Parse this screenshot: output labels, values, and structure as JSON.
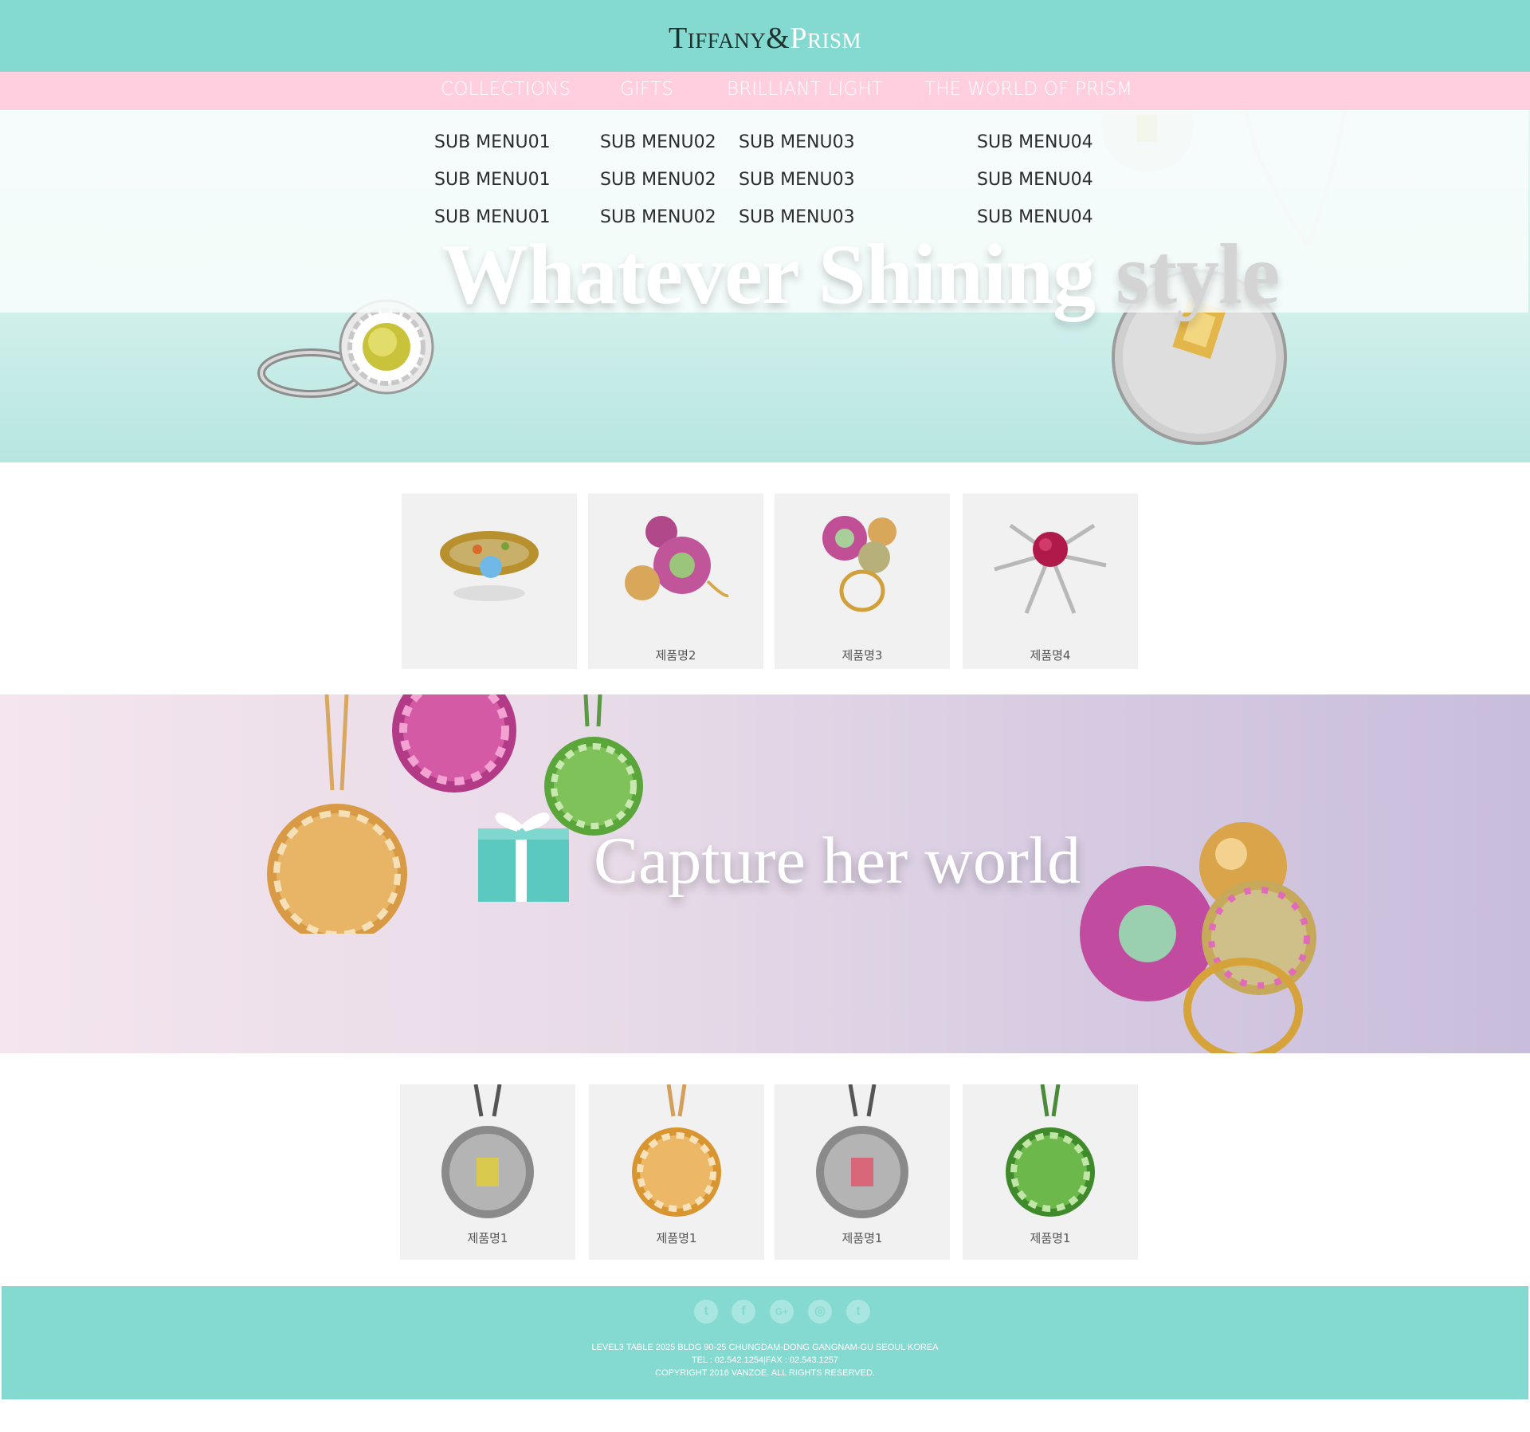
{
  "header": {
    "brand_left": "Tiffany&",
    "brand_right": "Prism"
  },
  "nav": {
    "items": [
      {
        "label": "COLLECTIONS"
      },
      {
        "label": "GIFTS"
      },
      {
        "label": "BRILLIANT LIGHT"
      },
      {
        "label": "THE WORLD OF PRISM"
      }
    ]
  },
  "submenu": {
    "col1": [
      "SUB MENU01",
      "SUB MENU01",
      "SUB MENU01"
    ],
    "col2": [
      "SUB MENU02",
      "SUB MENU02",
      "SUB MENU02"
    ],
    "col3": [
      "SUB MENU03",
      "SUB MENU03",
      "SUB MENU03"
    ],
    "col4": [
      "SUB MENU04",
      "SUB MENU04",
      "SUB MENU04"
    ]
  },
  "hero": {
    "title_main": "Whatever Shining ",
    "title_faded": "style"
  },
  "products_top": [
    {
      "name": "",
      "icon": "ring-icon"
    },
    {
      "name": "제품명2",
      "icon": "pearl-ring-icon"
    },
    {
      "name": "제품명3",
      "icon": "double-ball-ring-icon"
    },
    {
      "name": "제품명4",
      "icon": "star-brooch-icon"
    }
  ],
  "banner": {
    "title": "Capture her world"
  },
  "products_bottom": [
    {
      "name": "제품명1",
      "icon": "silver-pendant-yellow-icon"
    },
    {
      "name": "제품명1",
      "icon": "gold-pendant-icon"
    },
    {
      "name": "제품명1",
      "icon": "silver-pendant-pink-icon"
    },
    {
      "name": "제품명1",
      "icon": "green-pendant-icon"
    }
  ],
  "footer": {
    "social": [
      {
        "glyph": "t",
        "icon": "twitter-icon"
      },
      {
        "glyph": "f",
        "icon": "facebook-icon"
      },
      {
        "glyph": "G+",
        "icon": "google-plus-icon"
      },
      {
        "glyph": "◎",
        "icon": "instagram-icon"
      },
      {
        "glyph": "t",
        "icon": "tumblr-icon"
      }
    ],
    "address": "LEVEL3 TABLE 2025 BLDG 90-25 CHUNGDAM-DONG GANGNAM-GU SEOUL KOREA",
    "tel": "TEL : 02.542.1254|FAX : 02.543.1257",
    "copyright": "COPYRIGHT 2016 VANZOE. ALL RIGHTS RESERVED."
  },
  "colors": {
    "mint": "#84dad1",
    "pink": "#ffcfe0",
    "card": "#f1f1f1",
    "lavender": "#c8bddc"
  }
}
